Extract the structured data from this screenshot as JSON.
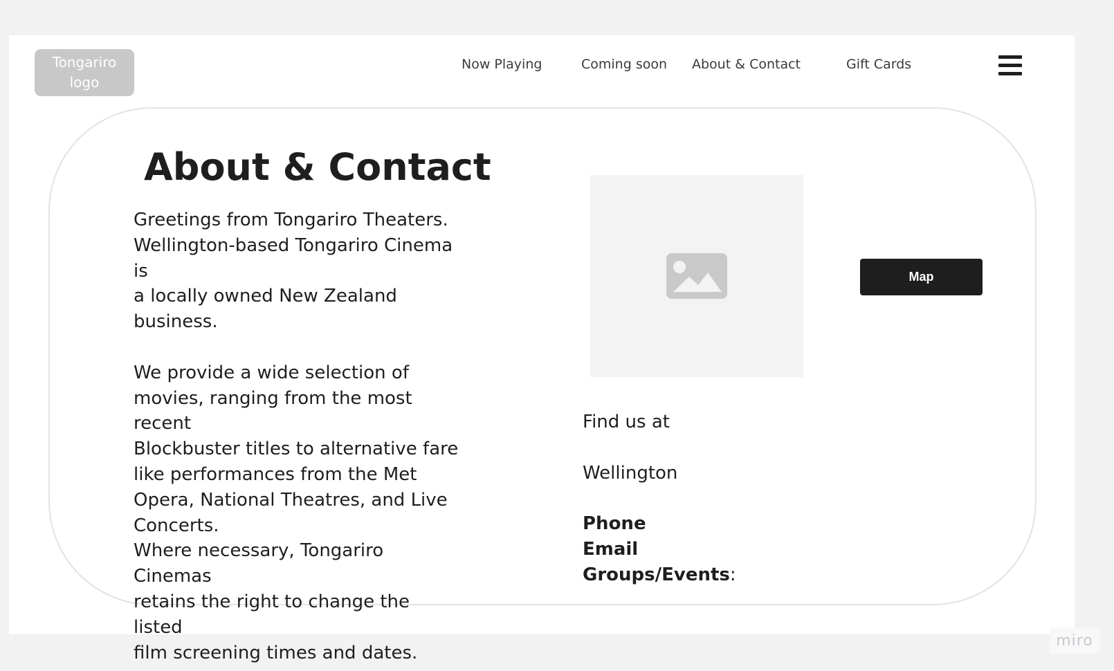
{
  "header": {
    "logo_text": "Tongariro\nlogo",
    "nav": [
      {
        "label": "Now Playing"
      },
      {
        "label": "Coming soon"
      },
      {
        "label": "About & Contact"
      },
      {
        "label": "Gift Cards"
      }
    ],
    "menu_icon": "hamburger-menu-icon"
  },
  "main": {
    "title": "About & Contact",
    "about_paragraph_1": "Greetings from Tongariro Theaters.\nWellington-based Tongariro Cinema is\na locally owned New Zealand\nbusiness.",
    "about_paragraph_2": "We provide a wide selection of\nmovies, ranging from the most recent\nBlockbuster titles to alternative fare\nlike performances from the Met\nOpera, National Theatres, and Live\nConcerts.\nWhere necessary, Tongariro Cinemas\nretains the right to change the listed\nfilm screening times and dates.",
    "image_icon": "image-placeholder-icon",
    "map_button_label": "Map",
    "contact": {
      "find_us_label": "Find us at",
      "location": "Wellington",
      "phone_label": "Phone",
      "email_label": "Email",
      "groups_label": "Groups/Events",
      "groups_suffix": ":"
    }
  },
  "watermark": "miro",
  "colors": {
    "background": "#f2f2f2",
    "frame": "#ffffff",
    "logo_bg": "#c8c8c8",
    "button_bg": "#1e1e1e",
    "text": "#1e1e1e",
    "placeholder_bg": "#f3f3f3"
  }
}
